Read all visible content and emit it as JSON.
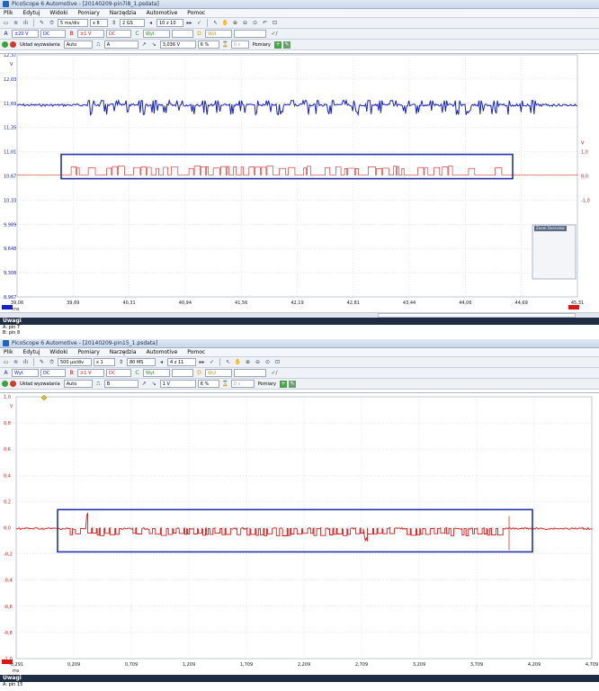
{
  "win1": {
    "title": "PicoScope 6 Automotive - [20140209-pin7i8_1.psdata]",
    "menu": [
      "Plik",
      "Edytuj",
      "Widoki",
      "Pomiary",
      "Narzędzia",
      "Automotive",
      "Pomoc"
    ],
    "timebase": "5 ms/div",
    "zoom": "x 8",
    "samples": "2 GS",
    "buffer_pos": "10",
    "buffer_of": "z 10",
    "chA_range": "±20 V",
    "chA_coupling": "DC",
    "chB_range": "±1 V",
    "chB_coupling": "DC",
    "chC_state": "Wył.",
    "chD_state": "Wył.",
    "trig_label": "Układ wyzwalania",
    "trig_mode": "Auto",
    "trig_source": "A",
    "trig_level": "3,036 V",
    "trig_pre": "6 %",
    "trig_delay": "0 s",
    "measure_btn": "Pomiary",
    "zoom_overview": "Zoom Overview",
    "notes_title": "Uwagi",
    "notes_lines": [
      "A: pin 7",
      "B: pin 8"
    ],
    "y_unit": "V",
    "y2_unit": "V",
    "y_ticks": [
      "12,37",
      "12,03",
      "11,69",
      "11,35",
      "11,01",
      "10,67",
      "10,33",
      "9,989",
      "9,648",
      "9,308",
      "8,967"
    ],
    "y2_ticks": [
      "1,0",
      "0,0",
      "-1,0"
    ],
    "x_unit": "ms",
    "x_ticks": [
      "39,06",
      "39,69",
      "40,31",
      "40,94",
      "41,56",
      "42,19",
      "42,81",
      "43,44",
      "44,06",
      "44,69",
      "45,31"
    ],
    "blue_color": "#1520c8",
    "red_color": "#d81818",
    "box_color": "#2632a8"
  },
  "win2": {
    "title": "PicoScope 6 Automotive - [20140209-pin15_1.psdata]",
    "menu": [
      "Plik",
      "Edytuj",
      "Widoki",
      "Pomiary",
      "Narzędzia",
      "Automotive",
      "Pomoc"
    ],
    "timebase": "500 µs/div",
    "zoom": "x 1",
    "samples": "80 MS",
    "buffer_pos": "4",
    "buffer_of": "z 11",
    "chA_state": "Wył.",
    "chA_coupling": "DC",
    "chB_range": "±1 V",
    "chB_coupling": "DC",
    "chC_state": "Wył.",
    "chD_state": "Wył.",
    "trig_label": "Układ wyzwalania",
    "trig_mode": "Auto",
    "trig_source": "B",
    "trig_level": "1 V",
    "trig_pre": "6 %",
    "trig_delay": "0 s",
    "measure_btn": "Pomiary",
    "notes_title": "Uwagi",
    "notes_lines": [
      "A: pin 15"
    ],
    "y_unit": "V",
    "y_ticks": [
      "1,0",
      "0,8",
      "0,6",
      "0,4",
      "0,2",
      "0,0",
      "-0,2",
      "-0,4",
      "-0,6",
      "-0,8",
      "-1,0"
    ],
    "x_unit": "ms",
    "x_ticks": [
      "-0,291",
      "0,209",
      "0,709",
      "1,209",
      "1,709",
      "2,209",
      "2,709",
      "3,209",
      "3,709",
      "4,209",
      "4,709"
    ],
    "red_color": "#d81818",
    "box_color": "#2632a8"
  }
}
